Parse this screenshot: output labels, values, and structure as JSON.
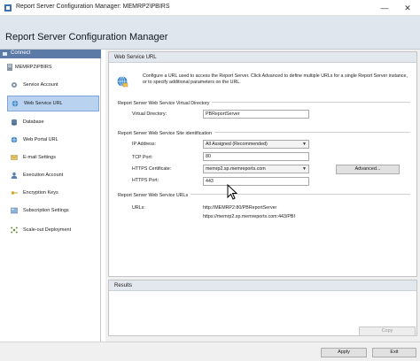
{
  "window": {
    "title": "Report Server Configuration Manager: MEMRP2\\PBIRS",
    "minimize": "—",
    "close": "✕"
  },
  "header": {
    "title": "Report Server Configuration Manager"
  },
  "sidebar": {
    "connect_label": "Connect",
    "server_label": "MEMRP2\\PBIRS",
    "items": [
      {
        "label": "Service Account",
        "icon": "gear-icon"
      },
      {
        "label": "Web Service URL",
        "icon": "globe-icon",
        "selected": true
      },
      {
        "label": "Database",
        "icon": "database-icon"
      },
      {
        "label": "Web Portal URL",
        "icon": "globe-icon"
      },
      {
        "label": "E-mail Settings",
        "icon": "email-icon"
      },
      {
        "label": "Execution Account",
        "icon": "user-icon"
      },
      {
        "label": "Encryption Keys",
        "icon": "key-icon"
      },
      {
        "label": "Subscription Settings",
        "icon": "settings-icon"
      },
      {
        "label": "Scale-out Deployment",
        "icon": "network-icon"
      }
    ]
  },
  "main": {
    "panel_title": "Web Service URL",
    "description": "Configure a URL used to access the Report Server.  Click Advanced to define multiple URLs for a single Report Server instance, or to specify additional parameters on the URL.",
    "virtual_directory": {
      "group_title": "Report Server Web Service Virtual Directory",
      "label": "Virtual Directory:",
      "value": "PBReportServer"
    },
    "site_identification": {
      "group_title": "Report Server Web Service Site identification",
      "ip_label": "IP Address:",
      "ip_value": "All Assigned (Recommended)",
      "tcp_label": "TCP Port:",
      "tcp_value": "80",
      "cert_label": "HTTPS Certificate:",
      "cert_value": "memrp2.sp.memreports.com",
      "https_label": "HTTPS Port:",
      "https_value": "443",
      "advanced_label": "Advanced..."
    },
    "urls": {
      "group_title": "Report Server Web Service URLs",
      "label": "URLs:",
      "url1": "http://MEMRP2:80/PBReportServer",
      "url2": "https://memrp2.sp.memreports.com:443/PBI"
    },
    "copy_label": "Copy",
    "results_title": "Results"
  },
  "footer": {
    "apply_label": "Apply",
    "exit_label": "Exit"
  }
}
